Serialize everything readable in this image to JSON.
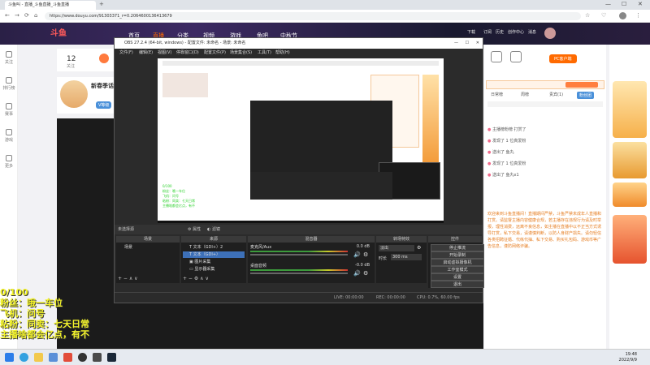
{
  "browser": {
    "tabs": [
      "斗鱼叫 - 直播_斗鱼直播_斗鱼直播",
      "新标签页"
    ],
    "url": "https://www.douyu.com/91303371_r=0.2064600136413679"
  },
  "site": {
    "nav": [
      "首页",
      "直播",
      "分类",
      "视频",
      "游戏",
      "鱼吧",
      "中秋节"
    ],
    "active_nav": "直播",
    "user_nav": [
      "下载",
      "订阅",
      "历史",
      "创作中心",
      "消息"
    ]
  },
  "leftnav": [
    "关注",
    "排行榜",
    "赛事",
    "游戏",
    "更多"
  ],
  "room": {
    "followers": "12",
    "follow_label": "关注",
    "streamer_name": "新春季话",
    "streamer_badge": "V等级",
    "pc_client": "PC客户端"
  },
  "obs": {
    "title": "OBS 27.2.4 (64-bit, windows) - 配置文件: 未命名 - 场景: 未命名",
    "menu": [
      "文件(F)",
      "编辑(E)",
      "视图(V)",
      "停靠窗口(D)",
      "配置文件(P)",
      "场景集合(S)",
      "工具(T)",
      "帮助(H)"
    ],
    "subbar": [
      "未选择源",
      "属性",
      "滤镜"
    ],
    "docks": {
      "scenes": "场景",
      "sources": "来源",
      "mixer": "混音器",
      "transitions": "转场特效",
      "controls": "控件"
    },
    "scene_items": [
      "场景"
    ],
    "source_items": [
      "文本（GDI+）2",
      "文本（GDI+）",
      "图片采集",
      "显示器采集"
    ],
    "mixer": [
      {
        "name": "麦克风/Aux",
        "db": "0.0 dB"
      },
      {
        "name": "桌面音频",
        "db": "-0.0 dB"
      }
    ],
    "transition": {
      "type": "淡出",
      "duration_label": "时长",
      "duration": "300 ms"
    },
    "controls": [
      "停止推流",
      "开始录制",
      "启动虚拟摄像机",
      "工作室模式",
      "设置",
      "退出"
    ],
    "status": [
      "LIVE: 00:00:00",
      "REC: 00:00:00",
      "CPU: 0.7%, 60.00 fps"
    ]
  },
  "rightpanel": {
    "tabs": [
      "日常榜",
      "周榜",
      "贵宾(1)",
      "粉丝团"
    ],
    "active_tab": "粉丝团",
    "messages": [
      "主播榜粉榜 打赏了 ",
      "发现了 1 位真爱粉",
      "送出了 鱼丸",
      "发现了 1 位真爱粉",
      "送出了 鱼丸x1"
    ],
    "notice": "欢迎来到斗鱼直播间！直播期间严禁，斗鱼严禁未成年人直播和打赏。请监督主播内容健康合规，若主播存在违规行为请及时举报，理性消费，远离不良信息，如主播在直播中以不正当方式诱导打赏，私下交易，请谨慎判断，以防人身财产损失。请勿轻信各类招聘征婚、代练代抽、私下交易、购买礼包码、游戏币等广告信息，谨防网络诈骗。"
  },
  "overlay": [
    "0/100",
    "粉丝：哦一车位",
    "飞机：问号",
    "粘粉：同卖：七天日常",
    "主播啥都会亿点，有不"
  ],
  "clock": {
    "time": "19:48",
    "date": "2022/9/9"
  }
}
